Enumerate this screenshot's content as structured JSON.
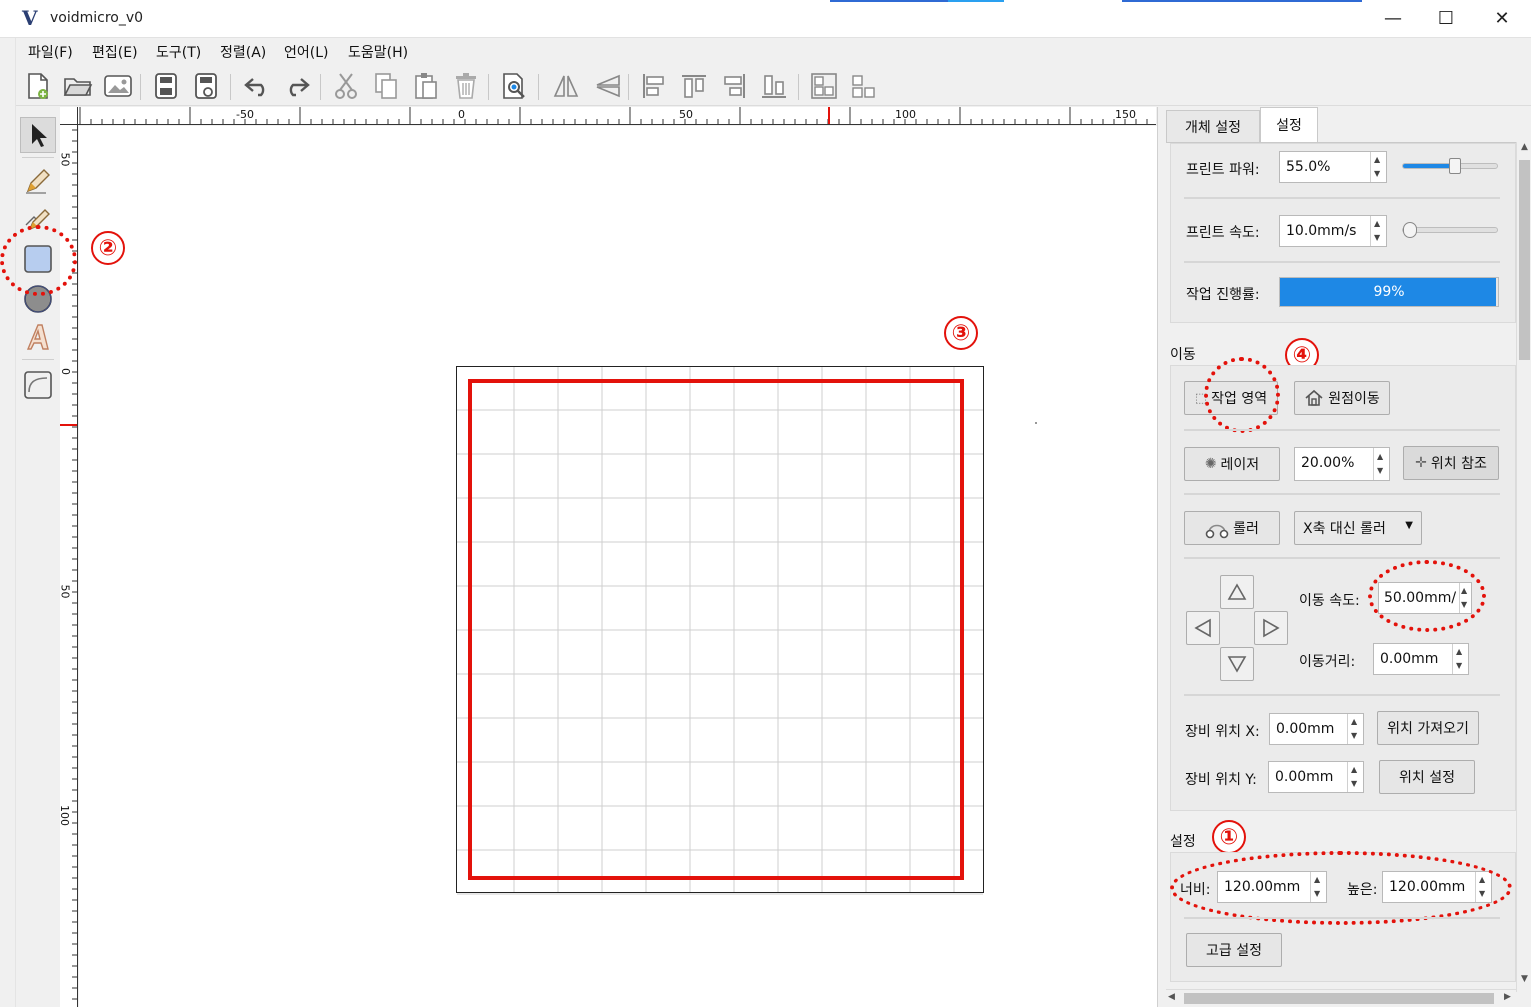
{
  "window": {
    "logo": "V",
    "title": "voidmicro_v0",
    "minimize": "—",
    "maximize": "☐",
    "close": "✕"
  },
  "menu": [
    "파일(F)",
    "편집(E)",
    "도구(T)",
    "정렬(A)",
    "언어(L)",
    "도움말(H)"
  ],
  "toolbar_icons": [
    "new-file-icon",
    "open-folder-icon",
    "open-image-icon",
    "save-icon",
    "save-as-icon",
    "undo-icon",
    "redo-icon",
    "cut-icon",
    "copy-icon",
    "paste-icon",
    "delete-icon",
    "preview-icon",
    "flip-horizontal-icon",
    "flip-vertical-icon",
    "align-left-icon",
    "align-top-icon",
    "align-right-icon",
    "align-bottom-icon",
    "group-icon",
    "ungroup-icon"
  ],
  "left_tools": [
    "pointer-icon",
    "pencil-icon",
    "polyline-pencil-icon",
    "rectangle-icon",
    "ellipse-icon",
    "text-icon",
    "image-frame-icon"
  ],
  "ruler": {
    "h_labels": [
      "-50",
      "0",
      "50",
      "100",
      "150"
    ],
    "v_labels": [
      "50",
      "0",
      "50",
      "100"
    ]
  },
  "annotations": {
    "n1": "①",
    "n2": "②",
    "n3": "③",
    "n4": "④"
  },
  "panel": {
    "tabs": [
      "개체 설정",
      "설정"
    ],
    "print_power_label": "프린트 파워:",
    "print_power_value": "55.0%",
    "print_power_level": 0.55,
    "print_speed_label": "프린트 속도:",
    "print_speed_value": "10.0mm/s",
    "print_speed_level": 0.05,
    "progress_label": "작업 진행률:",
    "progress_value": "99%",
    "progress_level": 0.99,
    "move_section": "이동",
    "work_area_button": "작업 영역",
    "origin_button": "원점이동",
    "laser_button": "레이저",
    "laser_value": "20.00%",
    "position_ref_button": "위치 참조",
    "roller_button": "롤러",
    "roller_select": "X축 대신 롤러",
    "move_speed_label": "이동 속도:",
    "move_speed_value": "50.00mm/",
    "move_distance_label": "이동거리:",
    "move_distance_value": "0.00mm",
    "device_x_label": "장비 위치 X:",
    "device_x_value": "0.00mm",
    "get_position_button": "위치 가져오기",
    "device_y_label": "장비 위치 Y:",
    "device_y_value": "0.00mm",
    "set_position_button": "위치 설정",
    "settings_section": "설정",
    "width_label": "너비:",
    "width_value": "120.00mm",
    "height_label": "높은:",
    "height_value": "120.00mm",
    "advanced_button": "고급 설정"
  },
  "colors": {
    "accent": "#1e88e5",
    "annotation": "#e3120b",
    "work_area": "#e3120b"
  }
}
